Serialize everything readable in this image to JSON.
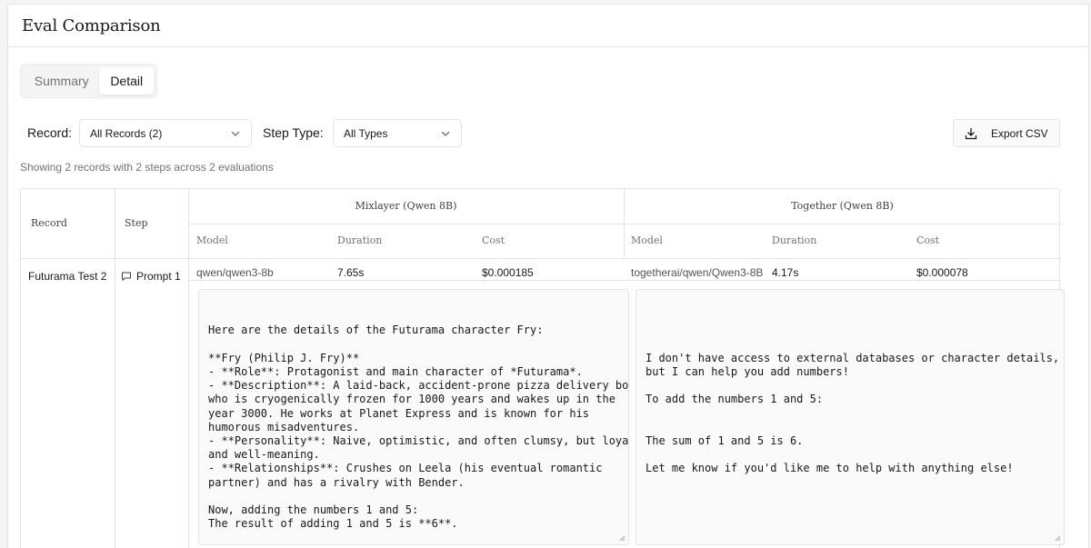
{
  "header": {
    "title": "Eval Comparison"
  },
  "tabs": [
    {
      "label": "Summary",
      "active": false
    },
    {
      "label": "Detail",
      "active": true
    }
  ],
  "filters": {
    "record_label": "Record:",
    "record_value": "All Records (2)",
    "step_type_label": "Step Type:",
    "step_type_value": "All Types"
  },
  "export": {
    "label": "Export CSV",
    "icon": "download-icon"
  },
  "summary_text": "Showing 2 records with 2 steps across 2 evaluations",
  "table": {
    "record_header": "Record",
    "step_header": "Step",
    "evaluations": [
      {
        "name": "Mixlayer (Qwen 8B)",
        "model_label": "Model",
        "duration_label": "Duration",
        "cost_label": "Cost"
      },
      {
        "name": "Together (Qwen 8B)",
        "model_label": "Model",
        "duration_label": "Duration",
        "cost_label": "Cost"
      }
    ],
    "rows": [
      {
        "record": "Futurama Test 2",
        "step": "Prompt 1",
        "step_icon": "message-icon",
        "results": [
          {
            "model": "qwen/qwen3-8b",
            "duration": "7.65s",
            "cost": "$0.000185",
            "output": "Here are the details of the Futurama character Fry:\n\n**Fry (Philip J. Fry)**\n- **Role**: Protagonist and main character of *Futurama*.\n- **Description**: A laid-back, accident-prone pizza delivery boy\nwho is cryogenically frozen for 1000 years and wakes up in the\nyear 3000. He works at Planet Express and is known for his\nhumorous misadventures.\n- **Personality**: Naive, optimistic, and often clumsy, but loyal\nand well-meaning.\n- **Relationships**: Crushes on Leela (his eventual romantic\npartner) and has a rivalry with Bender.\n\nNow, adding the numbers 1 and 5:\nThe result of adding 1 and 5 is **6**."
          },
          {
            "model": "togetherai/qwen/Qwen3-8B",
            "duration": "4.17s",
            "cost": "$0.000078",
            "output": "\n\nI don't have access to external databases or character details,\nbut I can help you add numbers!\n\nTo add the numbers 1 and 5:\n\n\nThe sum of 1 and 5 is 6.\n\nLet me know if you'd like me to help with anything else!"
          }
        ]
      }
    ]
  }
}
